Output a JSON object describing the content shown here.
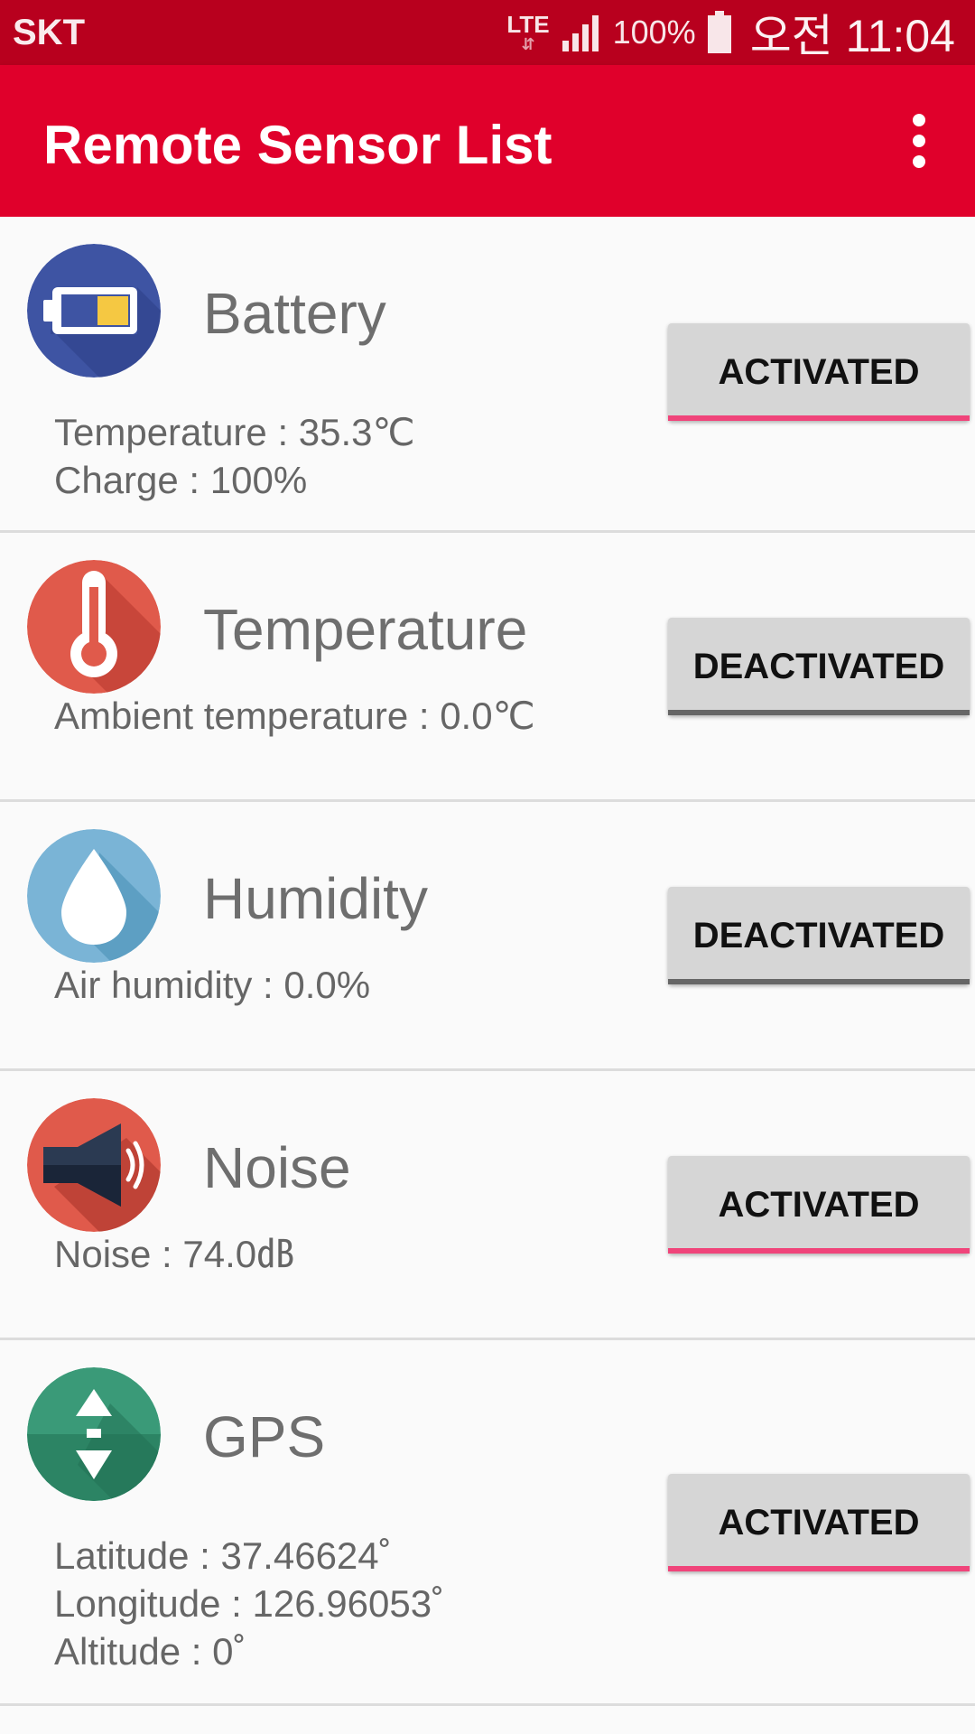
{
  "status_bar": {
    "carrier": "SKT",
    "network": "LTE",
    "network_arrows": "⇵",
    "battery_percent": "100%",
    "clock": "오전 11:04"
  },
  "app_bar": {
    "title": "Remote Sensor List",
    "menu_icon": "more-vert-icon"
  },
  "sensors": [
    {
      "name": "Battery",
      "icon": "battery-icon",
      "details": [
        "Temperature : 35.3℃",
        "Charge : 100%"
      ],
      "button_label": "ACTIVATED",
      "underline_color": "#f0447a"
    },
    {
      "name": "Temperature",
      "icon": "thermometer-icon",
      "details": [
        "Ambient temperature : 0.0℃"
      ],
      "button_label": "DEACTIVATED",
      "underline_color": "#666666"
    },
    {
      "name": "Humidity",
      "icon": "water-drop-icon",
      "details": [
        "Air humidity : 0.0%"
      ],
      "button_label": "DEACTIVATED",
      "underline_color": "#666666"
    },
    {
      "name": "Noise",
      "icon": "speaker-icon",
      "details": [
        "Noise : 74.0㏈"
      ],
      "button_label": "ACTIVATED",
      "underline_color": "#f0447a"
    },
    {
      "name": "GPS",
      "icon": "gps-icon",
      "details": [
        "Latitude : 37.46624˚",
        "Longitude : 126.96053˚",
        "Altitude : 0˚"
      ],
      "button_label": "ACTIVATED",
      "underline_color": "#f0447a"
    }
  ],
  "colors": {
    "status_bar": "#b8001e",
    "app_bar": "#e0002b",
    "activated_underline": "#f0447a",
    "deactivated_underline": "#666666"
  }
}
